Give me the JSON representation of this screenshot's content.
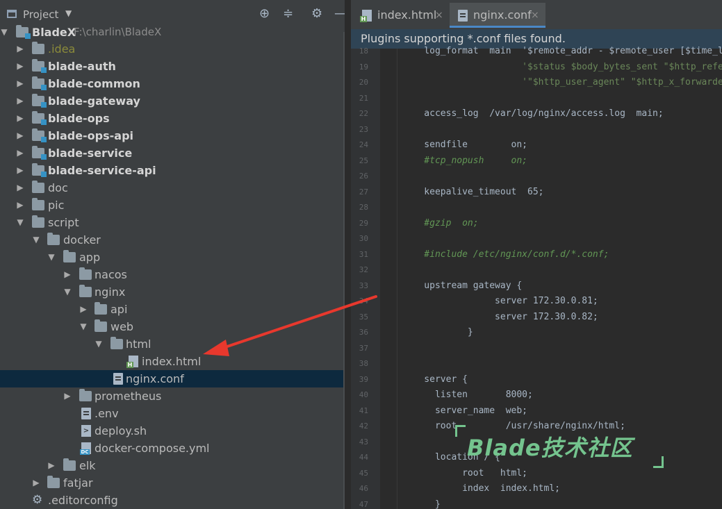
{
  "project_panel": {
    "title": "Project",
    "tree": [
      {
        "label": "BladeX",
        "path": "F:\\charlin\\BladeX",
        "kind": "module-root"
      },
      {
        "label": ".idea",
        "kind": "folder"
      },
      {
        "label": "blade-auth",
        "kind": "module"
      },
      {
        "label": "blade-common",
        "kind": "module"
      },
      {
        "label": "blade-gateway",
        "kind": "module"
      },
      {
        "label": "blade-ops",
        "kind": "module"
      },
      {
        "label": "blade-ops-api",
        "kind": "module"
      },
      {
        "label": "blade-service",
        "kind": "module"
      },
      {
        "label": "blade-service-api",
        "kind": "module"
      },
      {
        "label": "doc",
        "kind": "folder"
      },
      {
        "label": "pic",
        "kind": "folder"
      },
      {
        "label": "script",
        "kind": "folder"
      },
      {
        "label": "docker",
        "kind": "folder"
      },
      {
        "label": "app",
        "kind": "folder"
      },
      {
        "label": "nacos",
        "kind": "folder"
      },
      {
        "label": "nginx",
        "kind": "folder"
      },
      {
        "label": "api",
        "kind": "folder"
      },
      {
        "label": "web",
        "kind": "folder"
      },
      {
        "label": "html",
        "kind": "folder"
      },
      {
        "label": "index.html",
        "kind": "html-file"
      },
      {
        "label": "nginx.conf",
        "kind": "conf-file"
      },
      {
        "label": "prometheus",
        "kind": "folder"
      },
      {
        "label": ".env",
        "kind": "file"
      },
      {
        "label": "deploy.sh",
        "kind": "shell-file"
      },
      {
        "label": "docker-compose.yml",
        "kind": "compose-file"
      },
      {
        "label": "elk",
        "kind": "folder"
      },
      {
        "label": "fatjar",
        "kind": "folder"
      },
      {
        "label": ".editorconfig",
        "kind": "config-file"
      }
    ]
  },
  "editor": {
    "tabs": [
      {
        "label": "index.html",
        "close": "×",
        "active": false
      },
      {
        "label": "nginx.conf",
        "close": "×",
        "active": true
      }
    ],
    "notification": "Plugins supporting *.conf files found.",
    "lines": [
      {
        "num": "18",
        "text": "    log_format  main  '$remote_addr - $remote_user [$time_local]"
      },
      {
        "num": "19",
        "text": "                      '$status $body_bytes_sent \"$http_referer\" '"
      },
      {
        "num": "20",
        "text": "                      '\"$http_user_agent\" \"$http_x_forwarded_for\"';"
      },
      {
        "num": "21",
        "text": ""
      },
      {
        "num": "22",
        "text": "    access_log  /var/log/nginx/access.log  main;"
      },
      {
        "num": "23",
        "text": ""
      },
      {
        "num": "24",
        "text": "    sendfile        on;"
      },
      {
        "num": "25",
        "text": "    #tcp_nopush     on;"
      },
      {
        "num": "26",
        "text": ""
      },
      {
        "num": "27",
        "text": "    keepalive_timeout  65;"
      },
      {
        "num": "28",
        "text": ""
      },
      {
        "num": "29",
        "text": "    #gzip  on;"
      },
      {
        "num": "30",
        "text": ""
      },
      {
        "num": "31",
        "text": "    #include /etc/nginx/conf.d/*.conf;"
      },
      {
        "num": "32",
        "text": ""
      },
      {
        "num": "33",
        "text": "    upstream gateway {"
      },
      {
        "num": "34",
        "text": "                 server 172.30.0.81;"
      },
      {
        "num": "35",
        "text": "                 server 172.30.0.82;"
      },
      {
        "num": "36",
        "text": "            }"
      },
      {
        "num": "37",
        "text": ""
      },
      {
        "num": "38",
        "text": ""
      },
      {
        "num": "39",
        "text": "    server {"
      },
      {
        "num": "40",
        "text": "      listen       8000;"
      },
      {
        "num": "41",
        "text": "      server_name  web;"
      },
      {
        "num": "42",
        "text": "      root         /usr/share/nginx/html;"
      },
      {
        "num": "43",
        "text": ""
      },
      {
        "num": "44",
        "text": "      location / {"
      },
      {
        "num": "45",
        "text": "           root   html;"
      },
      {
        "num": "46",
        "text": "           index  index.html;"
      },
      {
        "num": "47",
        "text": "      }"
      }
    ]
  },
  "watermark": {
    "text": "Blade技术社区"
  },
  "annotation": {
    "color": "#e8382d"
  },
  "colors": {
    "selection": "#0d293e",
    "accent": "#4a88c7",
    "comment": "#629755",
    "notification": "#2f4455"
  }
}
